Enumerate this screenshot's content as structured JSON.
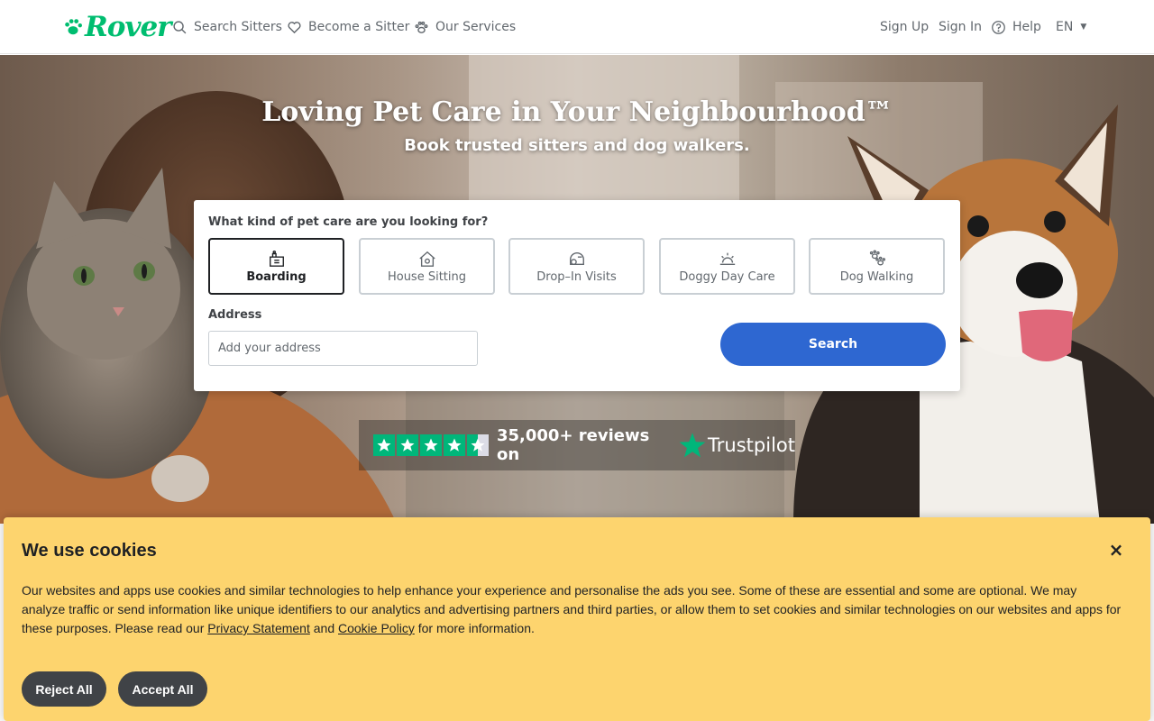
{
  "nav": {
    "logo_text": "Rover",
    "links": [
      {
        "label": "Search Sitters",
        "icon": "search-icon"
      },
      {
        "label": "Become a Sitter",
        "icon": "heart-icon"
      },
      {
        "label": "Our Services",
        "icon": "paw-icon"
      }
    ],
    "sign_up": "Sign Up",
    "sign_in": "Sign In",
    "help": "Help",
    "language": "EN"
  },
  "hero": {
    "title": "Loving Pet Care in Your Neighbourhood™",
    "subtitle": "Book trusted sitters and dog walkers."
  },
  "search": {
    "question": "What kind of pet care are you looking for?",
    "services": [
      {
        "label": "Boarding",
        "icon": "boarding-icon",
        "selected": true
      },
      {
        "label": "House Sitting",
        "icon": "house-sitting-icon",
        "selected": false
      },
      {
        "label": "Drop–In Visits",
        "icon": "drop-in-icon",
        "selected": false
      },
      {
        "label": "Doggy Day Care",
        "icon": "day-care-icon",
        "selected": false
      },
      {
        "label": "Dog Walking",
        "icon": "dog-walking-icon",
        "selected": false
      }
    ],
    "address_label": "Address",
    "address_placeholder": "Add your address",
    "address_value": "",
    "button": "Search"
  },
  "trustpilot": {
    "stars": 4.5,
    "reviews_text": "35,000+ reviews on",
    "brand": "Trustpilot"
  },
  "cookie": {
    "title": "We use cookies",
    "body_before": "Our websites and apps use cookies and similar technologies to help enhance your experience and personalise the ads you see. Some of these are essential and some are optional. We may analyze traffic or send information like unique identifiers to our analytics and advertising partners and third parties, or allow them to set cookies and similar technologies on our websites and apps for these purposes. Please read our ",
    "privacy_link": "Privacy Statement",
    "and_text": " and ",
    "cookie_link": "Cookie Policy",
    "body_after": " for more information.",
    "reject": "Reject All",
    "accept": "Accept All",
    "close": "×"
  },
  "colors": {
    "brand_green": "#00bd70",
    "search_blue": "#2e67d1",
    "cookie_yellow": "#fdd46e",
    "trustpilot_green": "#00b67a"
  }
}
